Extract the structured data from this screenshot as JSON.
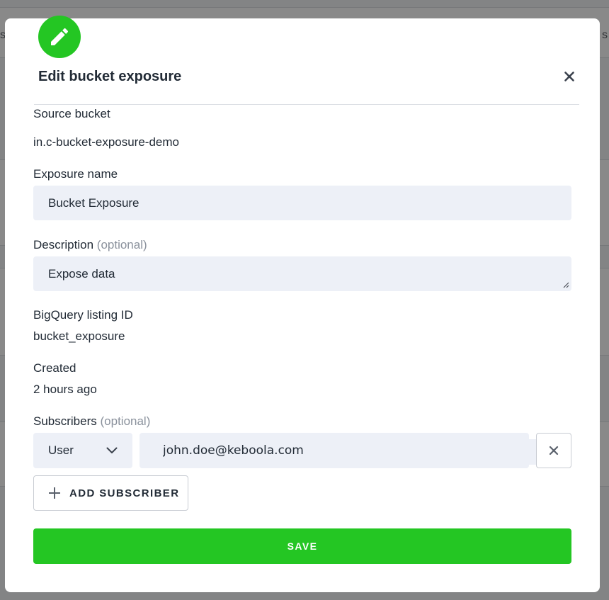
{
  "background": {
    "left_edge_text": "s",
    "right_edge_text": "s"
  },
  "modal": {
    "title": "Edit bucket exposure",
    "badge_icon": "pencil-icon",
    "close_icon": "close-icon",
    "accent_color": "#24c623"
  },
  "form": {
    "source_bucket": {
      "label": "Source bucket",
      "value": "in.c-bucket-exposure-demo"
    },
    "exposure_name": {
      "label": "Exposure name",
      "value": "Bucket Exposure"
    },
    "description": {
      "label": "Description",
      "optional": "(optional)",
      "value": "Expose data"
    },
    "listing_id": {
      "label": "BigQuery listing ID",
      "value": "bucket_exposure"
    },
    "created": {
      "label": "Created",
      "value": "2 hours ago"
    },
    "subscribers": {
      "label": "Subscribers",
      "optional": "(optional)",
      "items": [
        {
          "role": "User",
          "email": "john.doe@keboola.com"
        }
      ],
      "add_label": "ADD SUBSCRIBER"
    }
  },
  "actions": {
    "save_label": "SAVE"
  }
}
